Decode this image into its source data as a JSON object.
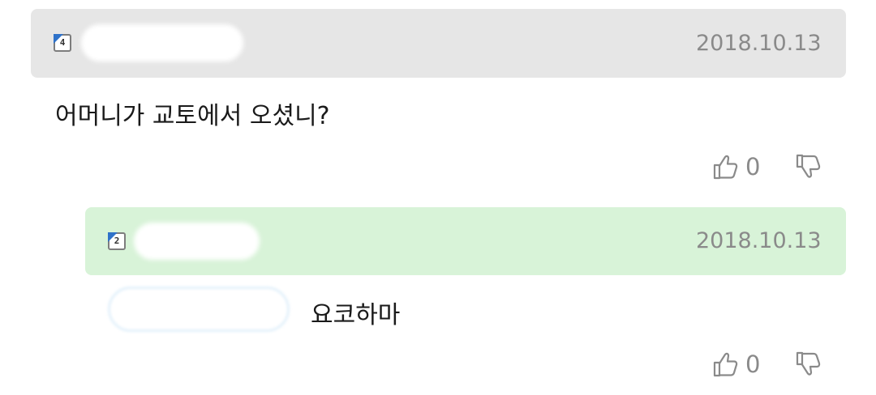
{
  "comments": [
    {
      "level": "4",
      "date": "2018.10.13",
      "text": "어머니가 교토에서 오셨니?",
      "upvotes": "0",
      "header_color": "#e6e6e6"
    },
    {
      "level": "2",
      "date": "2018.10.13",
      "text": "요코하마",
      "upvotes": "0",
      "header_color": "#d8f3d8"
    }
  ],
  "icons": {
    "level": "level-badge-icon",
    "up": "thumbs-up-icon",
    "down": "thumbs-down-icon"
  },
  "colors": {
    "level_corner": "#2f72c9",
    "muted_text": "#8a8a8a"
  }
}
